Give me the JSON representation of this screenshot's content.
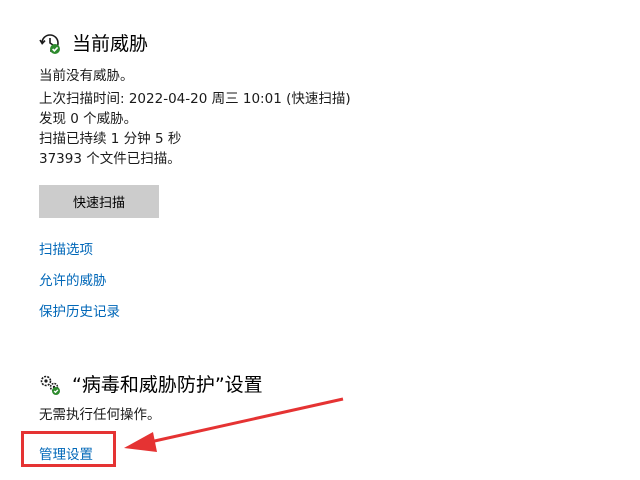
{
  "threats": {
    "title": "当前威胁",
    "icon": "history-shield-icon",
    "lines": [
      "当前没有威胁。",
      "上次扫描时间: 2022-04-20 周三 10:01 (快速扫描)",
      "发现 0 个威胁。",
      "扫描已持续 1 分钟 5 秒",
      "37393 个文件已扫描。"
    ],
    "quick_scan_label": "快速扫描",
    "links": [
      "扫描选项",
      "允许的威胁",
      "保护历史记录"
    ]
  },
  "settings": {
    "title": "“病毒和威胁防护”设置",
    "icon": "gears-icon",
    "status": "无需执行任何操作。",
    "manage_label": "管理设置"
  },
  "colors": {
    "link": "#0067b8",
    "annotation": "#e53333",
    "button_bg": "#cccccc"
  }
}
